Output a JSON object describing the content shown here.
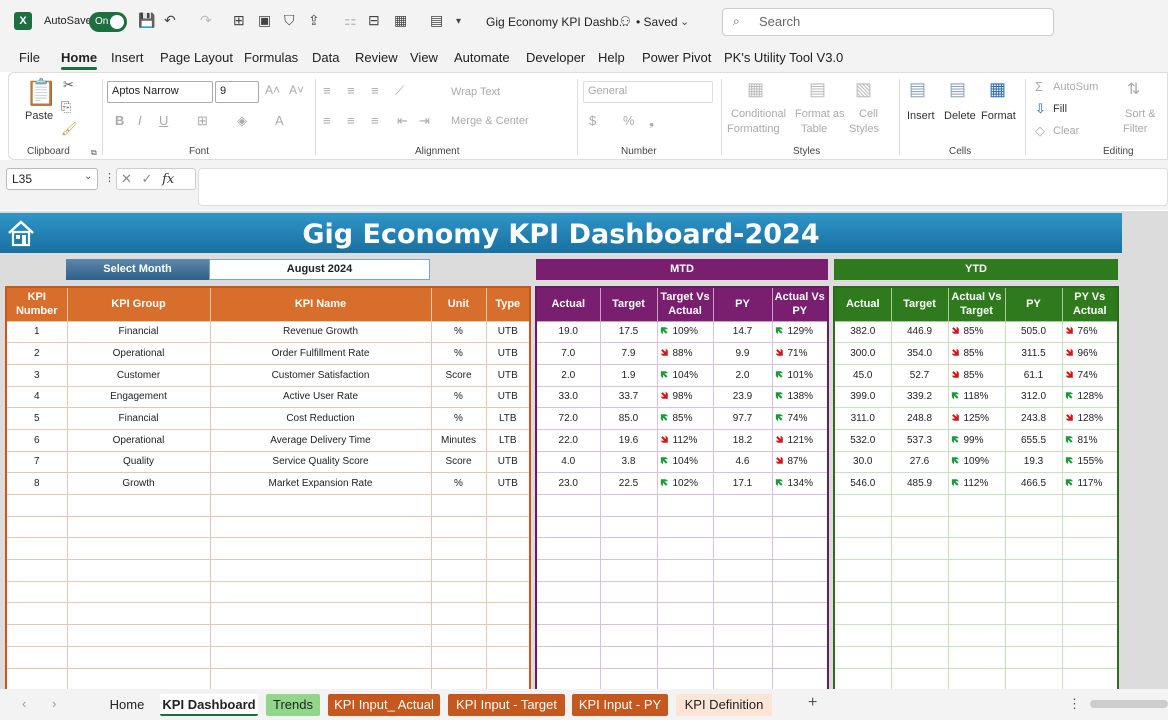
{
  "app": {
    "autosave_label": "AutoSave",
    "autosave_state": "On",
    "doc_title": "Gig Economy KPI Dashb...",
    "saved": "• Saved",
    "search_placeholder": "Search"
  },
  "menu": [
    "File",
    "Home",
    "Insert",
    "Page Layout",
    "Formulas",
    "Data",
    "Review",
    "View",
    "Automate",
    "Developer",
    "Help",
    "Power Pivot",
    "PK's Utility Tool V3.0"
  ],
  "ribbon": {
    "paste": "Paste",
    "font_name": "Aptos Narrow",
    "font_size": "9",
    "wrap_text": "Wrap Text",
    "merge_center": "Merge & Center",
    "number_format": "General",
    "cond_fmt_1": "Conditional",
    "cond_fmt_2": "Formatting",
    "fmt_table_1": "Format as",
    "fmt_table_2": "Table",
    "cell_styles_1": "Cell",
    "cell_styles_2": "Styles",
    "insert": "Insert",
    "delete": "Delete",
    "format": "Format",
    "autosum": "AutoSum",
    "fill": "Fill",
    "clear": "Clear",
    "sort_1": "Sort &",
    "sort_2": "Filter",
    "groups": {
      "clipboard": "Clipboard",
      "font": "Font",
      "alignment": "Alignment",
      "number": "Number",
      "styles": "Styles",
      "cells": "Cells",
      "editing": "Editing"
    }
  },
  "formula_bar": {
    "name_box": "L35",
    "fx": "fx"
  },
  "dashboard": {
    "title": "Gig Economy KPI Dashboard-2024",
    "select_month_label": "Select Month",
    "month": "August 2024",
    "mtd": "MTD",
    "ytd": "YTD",
    "left_headers": [
      "KPI Number",
      "KPI Group",
      "KPI Name",
      "Unit",
      "Type"
    ],
    "mtd_headers": [
      "Actual",
      "Target",
      "Target Vs Actual",
      "PY",
      "Actual Vs PY"
    ],
    "ytd_headers": [
      "Actual",
      "Target",
      "Actual Vs Target",
      "PY",
      "PY Vs Actual"
    ],
    "rows": [
      {
        "num": "1",
        "group": "Financial",
        "name": "Revenue Growth",
        "unit": "%",
        "type": "UTB",
        "m_act": "19.0",
        "m_tgt": "17.5",
        "m_tva": "109%",
        "m_tva_dir": "up",
        "m_py": "14.7",
        "m_avp": "129%",
        "m_avp_dir": "up",
        "y_act": "382.0",
        "y_tgt": "446.9",
        "y_avt": "85%",
        "y_avt_dir": "dn",
        "y_py": "505.0",
        "y_pva": "76%",
        "y_pva_dir": "dn"
      },
      {
        "num": "2",
        "group": "Operational",
        "name": "Order Fulfillment Rate",
        "unit": "%",
        "type": "UTB",
        "m_act": "7.0",
        "m_tgt": "7.9",
        "m_tva": "88%",
        "m_tva_dir": "dn",
        "m_py": "9.9",
        "m_avp": "71%",
        "m_avp_dir": "dn",
        "y_act": "300.0",
        "y_tgt": "354.0",
        "y_avt": "85%",
        "y_avt_dir": "dn",
        "y_py": "311.5",
        "y_pva": "96%",
        "y_pva_dir": "dn"
      },
      {
        "num": "3",
        "group": "Customer",
        "name": "Customer Satisfaction",
        "unit": "Score",
        "type": "UTB",
        "m_act": "2.0",
        "m_tgt": "1.9",
        "m_tva": "104%",
        "m_tva_dir": "up",
        "m_py": "2.0",
        "m_avp": "101%",
        "m_avp_dir": "up",
        "y_act": "45.0",
        "y_tgt": "52.7",
        "y_avt": "85%",
        "y_avt_dir": "dn",
        "y_py": "61.1",
        "y_pva": "74%",
        "y_pva_dir": "dn"
      },
      {
        "num": "4",
        "group": "Engagement",
        "name": "Active User Rate",
        "unit": "%",
        "type": "UTB",
        "m_act": "33.0",
        "m_tgt": "33.7",
        "m_tva": "98%",
        "m_tva_dir": "dn",
        "m_py": "23.9",
        "m_avp": "138%",
        "m_avp_dir": "up",
        "y_act": "399.0",
        "y_tgt": "339.2",
        "y_avt": "118%",
        "y_avt_dir": "up",
        "y_py": "312.0",
        "y_pva": "128%",
        "y_pva_dir": "up"
      },
      {
        "num": "5",
        "group": "Financial",
        "name": "Cost Reduction",
        "unit": "%",
        "type": "LTB",
        "m_act": "72.0",
        "m_tgt": "85.0",
        "m_tva": "85%",
        "m_tva_dir": "up",
        "m_py": "97.7",
        "m_avp": "74%",
        "m_avp_dir": "up",
        "y_act": "311.0",
        "y_tgt": "248.8",
        "y_avt": "125%",
        "y_avt_dir": "dn",
        "y_py": "243.8",
        "y_pva": "128%",
        "y_pva_dir": "dn"
      },
      {
        "num": "6",
        "group": "Operational",
        "name": "Average Delivery Time",
        "unit": "Minutes",
        "type": "LTB",
        "m_act": "22.0",
        "m_tgt": "19.6",
        "m_tva": "112%",
        "m_tva_dir": "dn",
        "m_py": "18.2",
        "m_avp": "121%",
        "m_avp_dir": "dn",
        "y_act": "532.0",
        "y_tgt": "537.3",
        "y_avt": "99%",
        "y_avt_dir": "up",
        "y_py": "655.5",
        "y_pva": "81%",
        "y_pva_dir": "up"
      },
      {
        "num": "7",
        "group": "Quality",
        "name": "Service Quality Score",
        "unit": "Score",
        "type": "UTB",
        "m_act": "4.0",
        "m_tgt": "3.8",
        "m_tva": "104%",
        "m_tva_dir": "up",
        "m_py": "4.6",
        "m_avp": "87%",
        "m_avp_dir": "dn",
        "y_act": "30.0",
        "y_tgt": "27.6",
        "y_avt": "109%",
        "y_avt_dir": "up",
        "y_py": "19.3",
        "y_pva": "155%",
        "y_pva_dir": "up"
      },
      {
        "num": "8",
        "group": "Growth",
        "name": "Market Expansion Rate",
        "unit": "%",
        "type": "UTB",
        "m_act": "23.0",
        "m_tgt": "22.5",
        "m_tva": "102%",
        "m_tva_dir": "up",
        "m_py": "17.1",
        "m_avp": "134%",
        "m_avp_dir": "up",
        "y_act": "546.0",
        "y_tgt": "485.9",
        "y_avt": "112%",
        "y_avt_dir": "up",
        "y_py": "466.5",
        "y_pva": "117%",
        "y_pva_dir": "up"
      }
    ]
  },
  "sheet_tabs": [
    {
      "label": "Home"
    },
    {
      "label": "KPI Dashboard",
      "active": true
    },
    {
      "label": "Trends",
      "color": "#92d68a"
    },
    {
      "label": "KPI Input_ Actual",
      "color": "#c4581e"
    },
    {
      "label": "KPI Input - Target",
      "color": "#c4581e"
    },
    {
      "label": "KPI Input - PY",
      "color": "#c4581e"
    },
    {
      "label": "KPI Definition",
      "color": "#fbe5d6"
    }
  ],
  "colors": {
    "excel_green": "#1d6f42",
    "banner": "#1f82b8",
    "kpi_orange": "#d86e2c",
    "mtd_purple": "#7a1f70",
    "ytd_green": "#2f7a1d",
    "up_arrow": "#1e9a3a",
    "down_arrow": "#d01818"
  }
}
